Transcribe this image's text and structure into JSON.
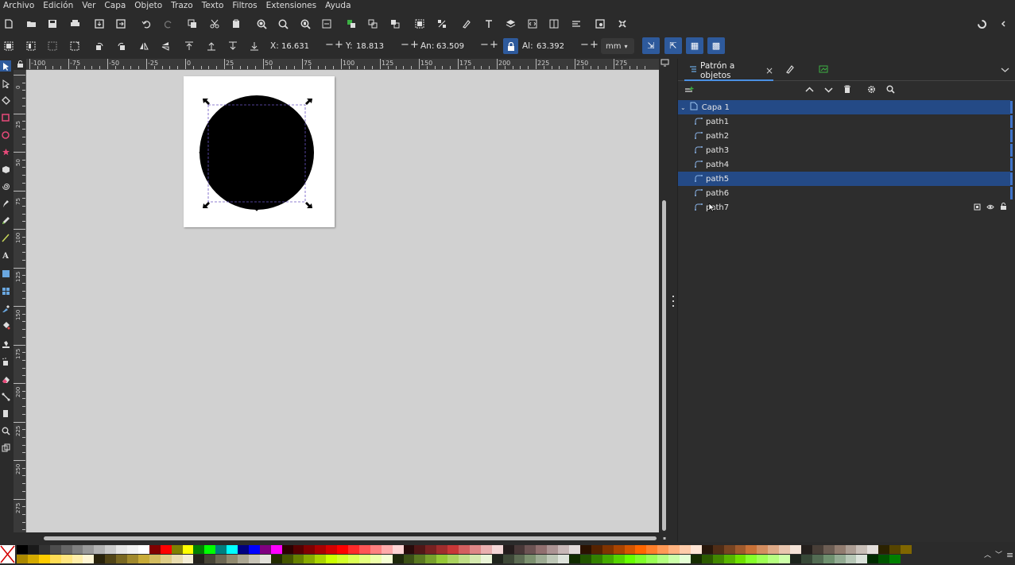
{
  "menu": [
    "Archivo",
    "Edición",
    "Ver",
    "Capa",
    "Objeto",
    "Trazo",
    "Texto",
    "Filtros",
    "Extensiones",
    "Ayuda"
  ],
  "controls": {
    "x_label": "X:",
    "x_value": "16.631",
    "y_label": "Y:",
    "y_value": "18.813",
    "w_label": "An:",
    "w_value": "63.509",
    "h_label": "Al:",
    "h_value": "63.392",
    "minus": "−",
    "plus": "+",
    "unit": "mm"
  },
  "ruler": {
    "h_labels": [
      "-100",
      "-75",
      "-50",
      "-25",
      "0",
      "25",
      "50",
      "75",
      "100",
      "125",
      "150",
      "175",
      "200",
      "225",
      "250",
      "275"
    ],
    "v_labels": [
      "0",
      "25",
      "50",
      "75",
      "100",
      "125",
      "150",
      "175",
      "200",
      "225",
      "250",
      "275"
    ]
  },
  "panel": {
    "tab_title": "Patrón a objetos",
    "tab_close": "×",
    "layer": "Capa 1",
    "items": [
      "path1",
      "path2",
      "path3",
      "path4",
      "path5",
      "path6",
      "path7"
    ],
    "selected_item": "path5"
  },
  "colors": {
    "accent": "#4a90e2",
    "selection": "#244a86",
    "canvas": "#d1d1d1",
    "shape": "#000000"
  },
  "palette_top": [
    "#000000",
    "#1a1a1a",
    "#333333",
    "#4d4d4d",
    "#666666",
    "#808080",
    "#999999",
    "#b3b3b3",
    "#cccccc",
    "#e6e6e6",
    "#f2f2f2",
    "#ffffff",
    "#800000",
    "#ff0000",
    "#808000",
    "#ffff00",
    "#008000",
    "#00ff00",
    "#008080",
    "#00ffff",
    "#000080",
    "#0000ff",
    "#800080",
    "#ff00ff",
    "#2b0000",
    "#550000",
    "#800000",
    "#aa0000",
    "#d40000",
    "#ff0000",
    "#ff2a2a",
    "#ff5555",
    "#ff8080",
    "#ffaaaa",
    "#ffd5d5",
    "#280b0b",
    "#501616",
    "#782121",
    "#a02c2c",
    "#c83737",
    "#d35f5f",
    "#de8787",
    "#e9afaf",
    "#f4d7d7",
    "#241c1c",
    "#483737",
    "#6c5353",
    "#916f6f",
    "#ac9393",
    "#c8b7b7",
    "#e3dbdb",
    "#2b1100",
    "#552200",
    "#803300",
    "#aa4400",
    "#d45500",
    "#ff6600",
    "#ff7f2a",
    "#ff9955",
    "#ffb380",
    "#ffccaa",
    "#ffe6d5",
    "#28170b",
    "#502d16",
    "#784421",
    "#a05a2c",
    "#c87137",
    "#d38d5f",
    "#deaa87",
    "#e9c6af",
    "#f4e3d7",
    "#241f1c",
    "#483e37",
    "#6c5d53",
    "#917c6f",
    "#ac9d93",
    "#c8beb7",
    "#e3dedb",
    "#2b2200",
    "#554400",
    "#806600"
  ],
  "palette_bottom": [
    "#aa8800",
    "#d4aa00",
    "#ffcc00",
    "#ffdd55",
    "#ffe680",
    "#ffeeaa",
    "#fff6d5",
    "#28220b",
    "#504416",
    "#786721",
    "#a0892c",
    "#c8ab37",
    "#d3bc5f",
    "#decd87",
    "#e9ddaf",
    "#f4eed7",
    "#24221c",
    "#484537",
    "#6c6753",
    "#918a6f",
    "#aca793",
    "#c8c4b7",
    "#e3e2db",
    "#222b00",
    "#445500",
    "#668000",
    "#88aa00",
    "#aad400",
    "#ccff00",
    "#d4ff2a",
    "#ddff55",
    "#e5ff80",
    "#eeffaa",
    "#f6ffd5",
    "#1e280b",
    "#3c5016",
    "#5a7821",
    "#78a02c",
    "#96c837",
    "#abd35f",
    "#c0de87",
    "#d5e9af",
    "#eaf4d7",
    "#1f241c",
    "#3e4837",
    "#5d6c53",
    "#7c916f",
    "#9dac93",
    "#bec8b7",
    "#dee3db",
    "#112b00",
    "#225500",
    "#338000",
    "#44aa00",
    "#55d400",
    "#66ff00",
    "#7fff2a",
    "#99ff55",
    "#b3ff80",
    "#ccffaa",
    "#e5ffd5",
    "#162d00",
    "#2c5a00",
    "#428700",
    "#58b400",
    "#6ee100",
    "#86ff2a",
    "#9eff55",
    "#b6ff80",
    "#ceffaa",
    "#1c241c",
    "#374837",
    "#536c53",
    "#6f916f",
    "#93ac93",
    "#b7c8b7",
    "#dbe3db",
    "#002b00",
    "#005500",
    "#008000"
  ]
}
